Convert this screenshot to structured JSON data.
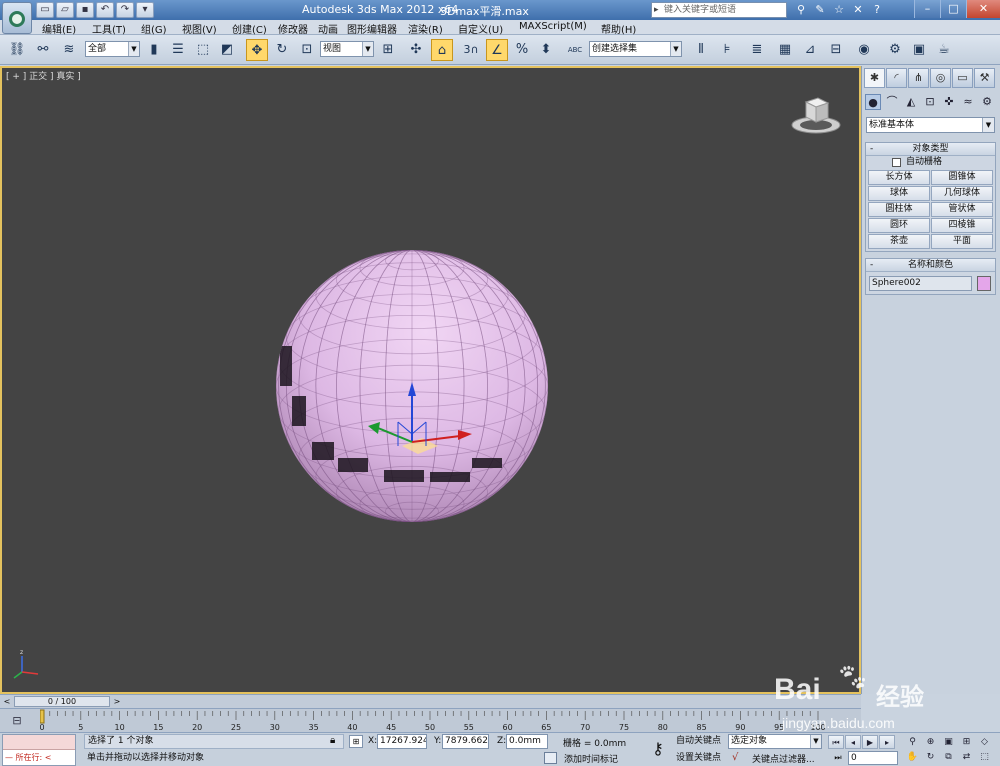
{
  "titlebar": {
    "app_title": "Autodesk 3ds Max  2012 x64",
    "file_name": "3Dmax平滑.max",
    "search_placeholder": "键入关键字或短语",
    "quick_access": [
      "new-icon",
      "open-icon",
      "save-icon",
      "undo-icon",
      "redo-icon",
      "dropdown-icon"
    ],
    "tools": [
      "binoculars-icon",
      "tools-icon",
      "star-icon",
      "close-x-icon"
    ],
    "help_glyph": "?"
  },
  "menubar": {
    "items": [
      "编辑(E)",
      "工具(T)",
      "组(G)",
      "视图(V)",
      "创建(C)",
      "修改器",
      "动画",
      "图形编辑器",
      "渲染(R)",
      "自定义(U)",
      "MAXScript(M)",
      "帮助(H)"
    ]
  },
  "toolbar": {
    "selection_filter": "全部",
    "ref_coord": "视图",
    "named_selection": "创建选择集",
    "snap_label": "3",
    "abc_label": "ABC"
  },
  "viewport": {
    "label": "[ + ] 正交 ] 真实 ]",
    "object_color": "#ddb8e4",
    "background": "#444444",
    "border": "#e4c25e"
  },
  "command_panel": {
    "primitive_type": "标准基本体",
    "object_type": {
      "title": "对象类型",
      "autogrid_label": "自动栅格",
      "buttons": [
        "长方体",
        "圆锥体",
        "球体",
        "几何球体",
        "圆柱体",
        "管状体",
        "圆环",
        "四棱锥",
        "茶壶",
        "平面"
      ]
    },
    "name_color": {
      "title": "名称和颜色",
      "name": "Sphere002",
      "color": "#e4a6ea"
    }
  },
  "timeslider": {
    "position": "0 / 100",
    "prev": "<",
    "next": ">"
  },
  "trackbar": {
    "ticks": [
      "0",
      "5",
      "10",
      "15",
      "20",
      "25",
      "30",
      "35",
      "40",
      "45",
      "50",
      "55",
      "60",
      "65",
      "70",
      "75",
      "80",
      "85",
      "90",
      "95",
      "100"
    ]
  },
  "status": {
    "maxscript_label": "所在行:",
    "selection": "选择了 1 个对象",
    "prompt": "单击并拖动以选择并移动对象",
    "x_label": "X:",
    "x_value": "17267.924",
    "y_label": "Y:",
    "y_value": "7879.662m",
    "z_label": "Z:",
    "z_value": "0.0mm",
    "grid": "栅格 = 0.0mm",
    "add_time_tag": "添加时间标记",
    "autokey": "自动关键点",
    "setkey": "设置关键点",
    "key_mode": "选定对象",
    "key_filters": "关键点过滤器...",
    "frame": "0"
  },
  "watermark": {
    "brand": "Bai",
    "brand_cn": "经验",
    "url": "jingyan.baidu.com"
  }
}
